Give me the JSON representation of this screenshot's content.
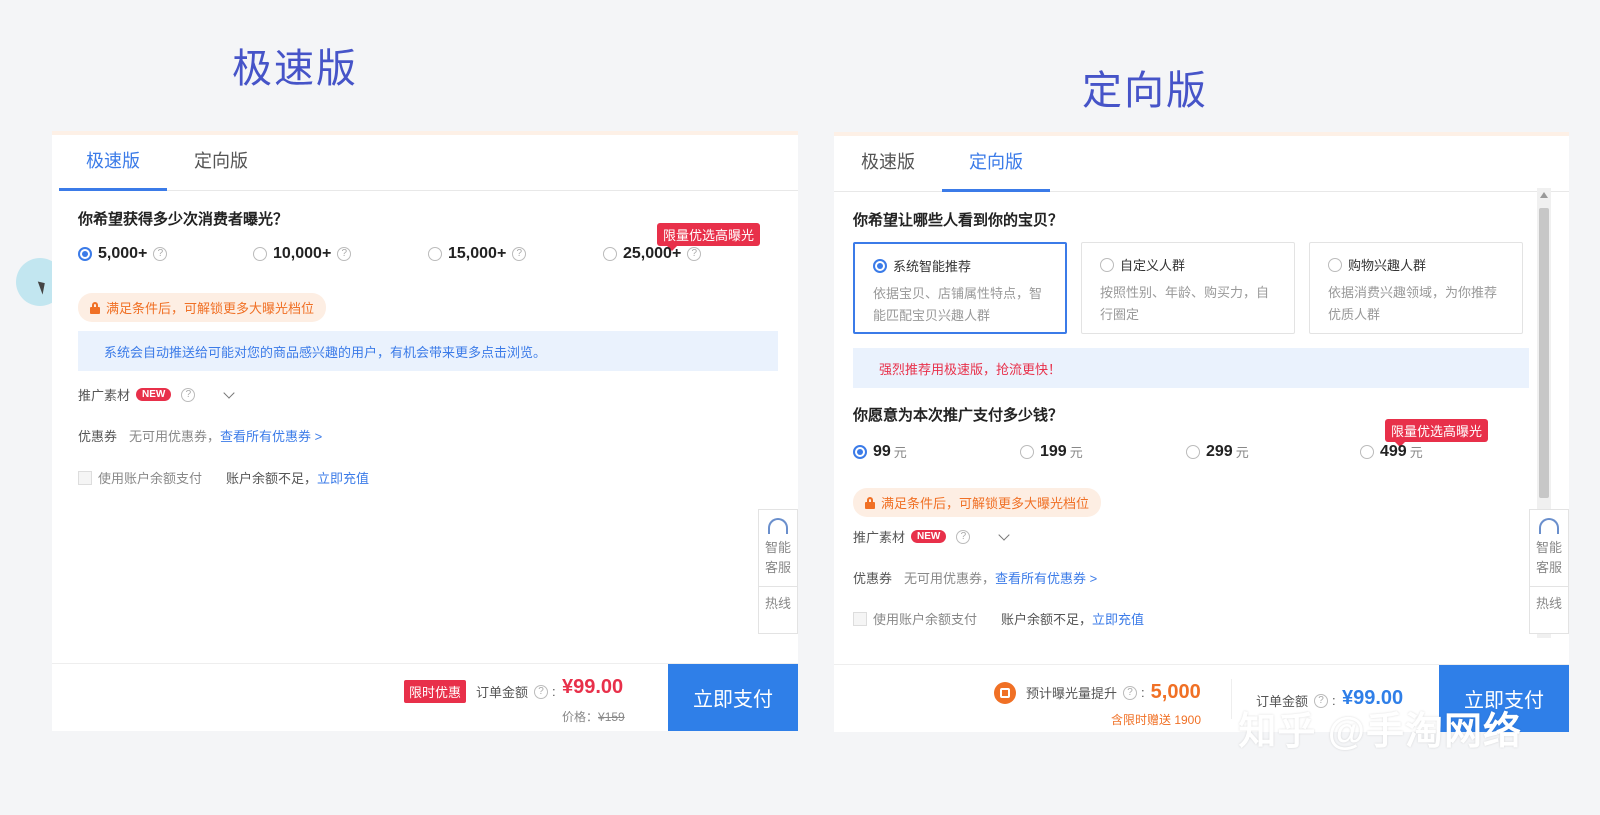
{
  "titles": {
    "left": "极速版",
    "right": "定向版"
  },
  "tabs": [
    "极速版",
    "定向版"
  ],
  "left": {
    "question": "你希望获得多少次消费者曝光？",
    "options": [
      "5,000+",
      "10,000+",
      "15,000+",
      "25,000+"
    ],
    "selected_index": 0,
    "hot_badge": "限量优选高曝光",
    "lock_tip": "满足条件后，可解锁更多大曝光档位",
    "info": "系统会自动推送给可能对您的商品感兴趣的用户，有机会带来更多点击浏览。",
    "material_label": "推广素材",
    "new_badge": "NEW",
    "coupon_label": "优惠券",
    "coupon_none": "无可用优惠券，",
    "coupon_link": "查看所有优惠券 >",
    "balance_label": "使用账户余额支付",
    "balance_insufficient": "账户余额不足，",
    "recharge_link": "立即充值",
    "promo_tag": "限时优惠",
    "order_label": "订单金额",
    "order_amount": "¥99.00",
    "original_price_label": "价格：",
    "original_price": "¥159",
    "pay_button": "立即支付"
  },
  "right": {
    "question": "你希望让哪些人看到你的宝贝？",
    "cards": [
      {
        "title": "系统智能推荐",
        "desc": "依据宝贝、店铺属性特点，智能匹配宝贝兴趣人群"
      },
      {
        "title": "自定义人群",
        "desc": "按照性别、年龄、购买力，自行圈定"
      },
      {
        "title": "购物兴趣人群",
        "desc": "依据消费兴趣领域，为你推荐优质人群"
      }
    ],
    "recommend_tip": "强烈推荐用极速版，抢流更快！",
    "pay_question": "你愿意为本次推广支付多少钱？",
    "amounts": [
      "99",
      "199",
      "299",
      "499"
    ],
    "amount_unit": "元",
    "hot_badge": "限量优选高曝光",
    "lock_tip": "满足条件后，可解锁更多大曝光档位",
    "material_label": "推广素材",
    "new_badge": "NEW",
    "coupon_label": "优惠券",
    "coupon_none": "无可用优惠券，",
    "coupon_link": "查看所有优惠券 >",
    "balance_label": "使用账户余额支付",
    "balance_insufficient": "账户余额不足，",
    "recharge_link": "立即充值",
    "exposure_label": "预计曝光量提升",
    "exposure_value": "5,000",
    "exposure_gift": "含限时赠送 1900",
    "order_label": "订单金额",
    "order_amount": "¥99.00",
    "pay_button": "立即支付"
  },
  "side_help": {
    "label1": "智能",
    "label2": "客服",
    "hotline": "热线"
  },
  "watermark": "知乎 @手淘网络",
  "colors": {
    "accent": "#3b7be8",
    "title": "#4654c8",
    "hot": "#e8304a",
    "orange": "#f07025"
  }
}
